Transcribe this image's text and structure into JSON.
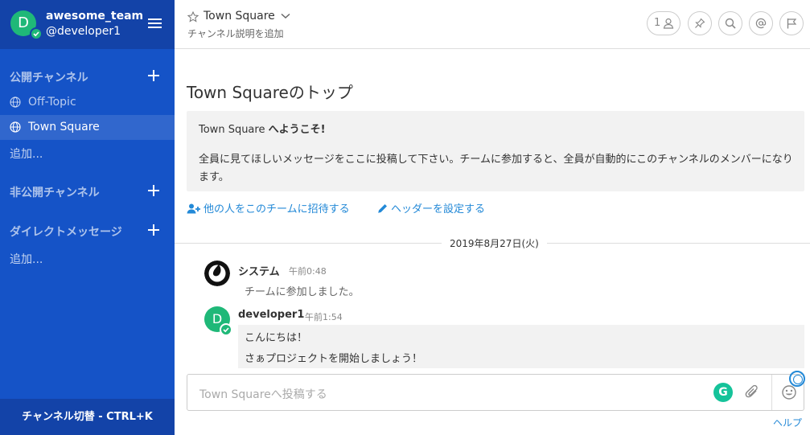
{
  "team": {
    "initial": "D",
    "name": "awesome_team",
    "user": "@developer1"
  },
  "sidebar": {
    "public_title": "公開チャンネル",
    "channels": [
      {
        "label": "Off-Topic",
        "active": false
      },
      {
        "label": "Town Square",
        "active": true
      }
    ],
    "add_more": "追加...",
    "private_title": "非公開チャンネル",
    "dm_title": "ダイレクトメッセージ",
    "dm_add_more": "追加...",
    "switch_label": "チャンネル切替 - CTRL+K"
  },
  "header": {
    "channel_name": "Town Square",
    "description": "チャンネル説明を追加",
    "member_count": "1"
  },
  "intro": {
    "title": "Town Squareのトップ",
    "welcome_name": "Town Square",
    "welcome_suffix": "へようこそ!",
    "text": "全員に見てほしいメッセージをここに投稿して下さい。チームに参加すると、全員が自動的にこのチャンネルのメンバーになります。",
    "invite_link": "他の人をこのチームに招待する",
    "header_link": "ヘッダーを設定する"
  },
  "date_separator": "2019年8月27日(火)",
  "posts": [
    {
      "author": "システム",
      "time": "午前0:48",
      "lines": [
        "チームに参加しました。"
      ]
    },
    {
      "author": "developer1",
      "initial": "D",
      "time": "午前1:54",
      "lines": [
        "こんにちは！",
        "さぁプロジェクトを開始しましょう！"
      ]
    }
  ],
  "input": {
    "placeholder": "Town Squareへ投稿する",
    "grammarly": "G"
  },
  "help": "ヘルプ",
  "colors": {
    "sidebar": "#1553c7",
    "team_header": "#1343a8",
    "online": "#1fb878",
    "link": "#2389d7"
  }
}
